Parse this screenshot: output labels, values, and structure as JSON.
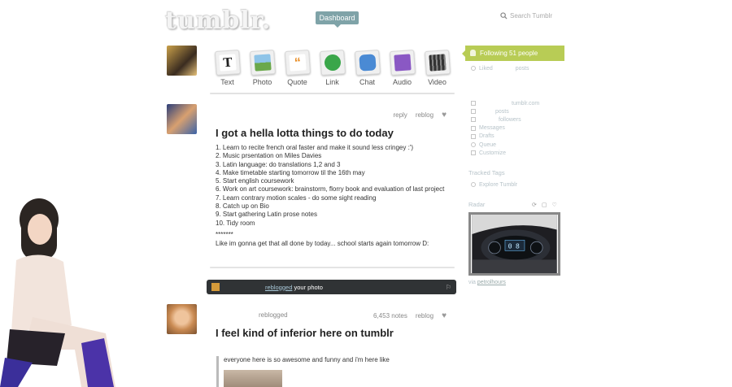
{
  "header": {
    "logo": "tumblr.",
    "dashboard_label": "Dashboard",
    "search_placeholder": "Search Tumblr"
  },
  "post_types": [
    {
      "label": "Text",
      "icon": "text-icon"
    },
    {
      "label": "Photo",
      "icon": "photo-icon"
    },
    {
      "label": "Quote",
      "icon": "quote-icon"
    },
    {
      "label": "Link",
      "icon": "link-icon"
    },
    {
      "label": "Chat",
      "icon": "chat-icon"
    },
    {
      "label": "Audio",
      "icon": "audio-icon"
    },
    {
      "label": "Video",
      "icon": "video-icon"
    }
  ],
  "post1": {
    "reply": "reply",
    "reblog": "reblog",
    "title": "I got a hella lotta things to do today",
    "lines": [
      "1. Learn to recite french oral faster and make it sound less cringey :')",
      "2. Music prsentation on Miles Davies",
      "3. Latin language: do translations 1,2 and 3",
      "4. Make timetable starting tomorrow til the 16th may",
      "5. Start english coursework",
      "6. Work on art coursework: brainstorm, florry book and evaluation of last project",
      "7. Learn contrary motion scales - do some sight reading",
      "8. Catch up on Bio",
      "9. Start gathering Latin prose notes",
      "10. Tidy room"
    ],
    "separator": "*******",
    "footer": "Like im gonna get that all done by today... school starts again tomorrow D:"
  },
  "reblog_bar": {
    "reblogged": "reblogged",
    "your_photo": "your photo"
  },
  "post2": {
    "reblogged": "reblogged",
    "notes": "6,453 notes",
    "reblog": "reblog",
    "title": "I feel kind of inferior here on tumblr",
    "quote": "everyone here is so awesome and funny and i'm here like"
  },
  "sidebar": {
    "following": "Following 51 people",
    "liked": "Liked",
    "posts": "posts",
    "blog_url": "tumblr.com",
    "blog_posts": "posts",
    "followers": "followers",
    "links": [
      "Messages",
      "Drafts",
      "Queue",
      "Customize"
    ],
    "tracked_tags": "Tracked Tags",
    "explore": "Explore Tumblr",
    "radar": "Radar",
    "via": "via",
    "via_user": "petrolhours"
  },
  "colors": {
    "dashboard": "#7fa3a8",
    "following": "#b8cc55",
    "reblog_bar": "#303335"
  }
}
